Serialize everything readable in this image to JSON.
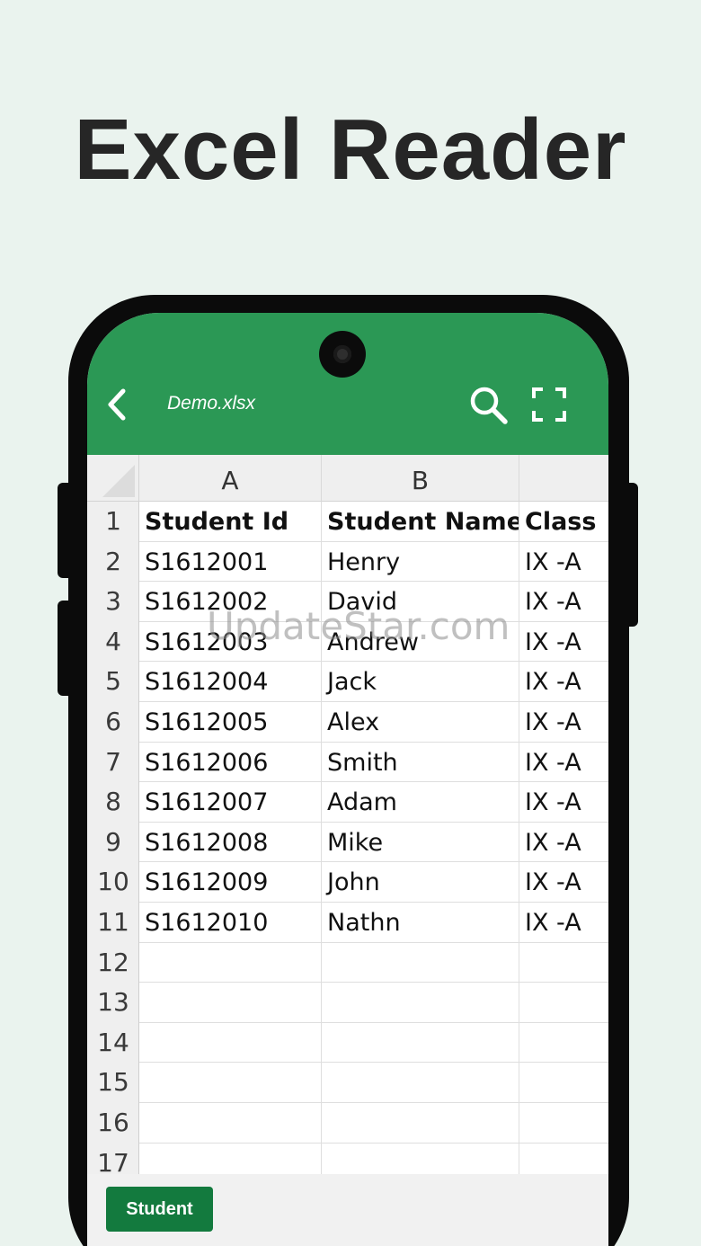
{
  "headline": "Excel Reader",
  "app_bar": {
    "file_name": "Demo.xlsx",
    "back_icon": "chevron-left-icon",
    "search_icon": "search-icon",
    "fullscreen_icon": "fullscreen-icon"
  },
  "colors": {
    "background": "#eaf3ee",
    "app_bar": "#2b9855",
    "sheet_tab": "#137a3e"
  },
  "sheet": {
    "column_headers": [
      "A",
      "B",
      ""
    ],
    "rows": [
      {
        "num": "1",
        "cells": [
          "Student Id",
          "Student Name",
          "Class"
        ]
      },
      {
        "num": "2",
        "cells": [
          "S1612001",
          "Henry",
          "IX -A"
        ]
      },
      {
        "num": "3",
        "cells": [
          "S1612002",
          "David",
          "IX -A"
        ]
      },
      {
        "num": "4",
        "cells": [
          "S1612003",
          "Andrew",
          "IX -A"
        ]
      },
      {
        "num": "5",
        "cells": [
          "S1612004",
          "Jack",
          "IX -A"
        ]
      },
      {
        "num": "6",
        "cells": [
          "S1612005",
          "Alex",
          "IX -A"
        ]
      },
      {
        "num": "7",
        "cells": [
          "S1612006",
          "Smith",
          "IX -A"
        ]
      },
      {
        "num": "8",
        "cells": [
          "S1612007",
          "Adam",
          "IX -A"
        ]
      },
      {
        "num": "9",
        "cells": [
          "S1612008",
          "Mike",
          "IX -A"
        ]
      },
      {
        "num": "10",
        "cells": [
          "S1612009",
          "John",
          "IX -A"
        ]
      },
      {
        "num": "11",
        "cells": [
          "S1612010",
          "Nathn",
          "IX -A"
        ]
      },
      {
        "num": "12",
        "cells": [
          "",
          "",
          ""
        ]
      },
      {
        "num": "13",
        "cells": [
          "",
          "",
          ""
        ]
      },
      {
        "num": "14",
        "cells": [
          "",
          "",
          ""
        ]
      },
      {
        "num": "15",
        "cells": [
          "",
          "",
          ""
        ]
      },
      {
        "num": "16",
        "cells": [
          "",
          "",
          ""
        ]
      },
      {
        "num": "17",
        "cells": [
          "",
          "",
          ""
        ]
      }
    ]
  },
  "sheet_tabs": [
    {
      "label": "Student",
      "active": true
    }
  ],
  "watermark": "UpdateStar.com"
}
